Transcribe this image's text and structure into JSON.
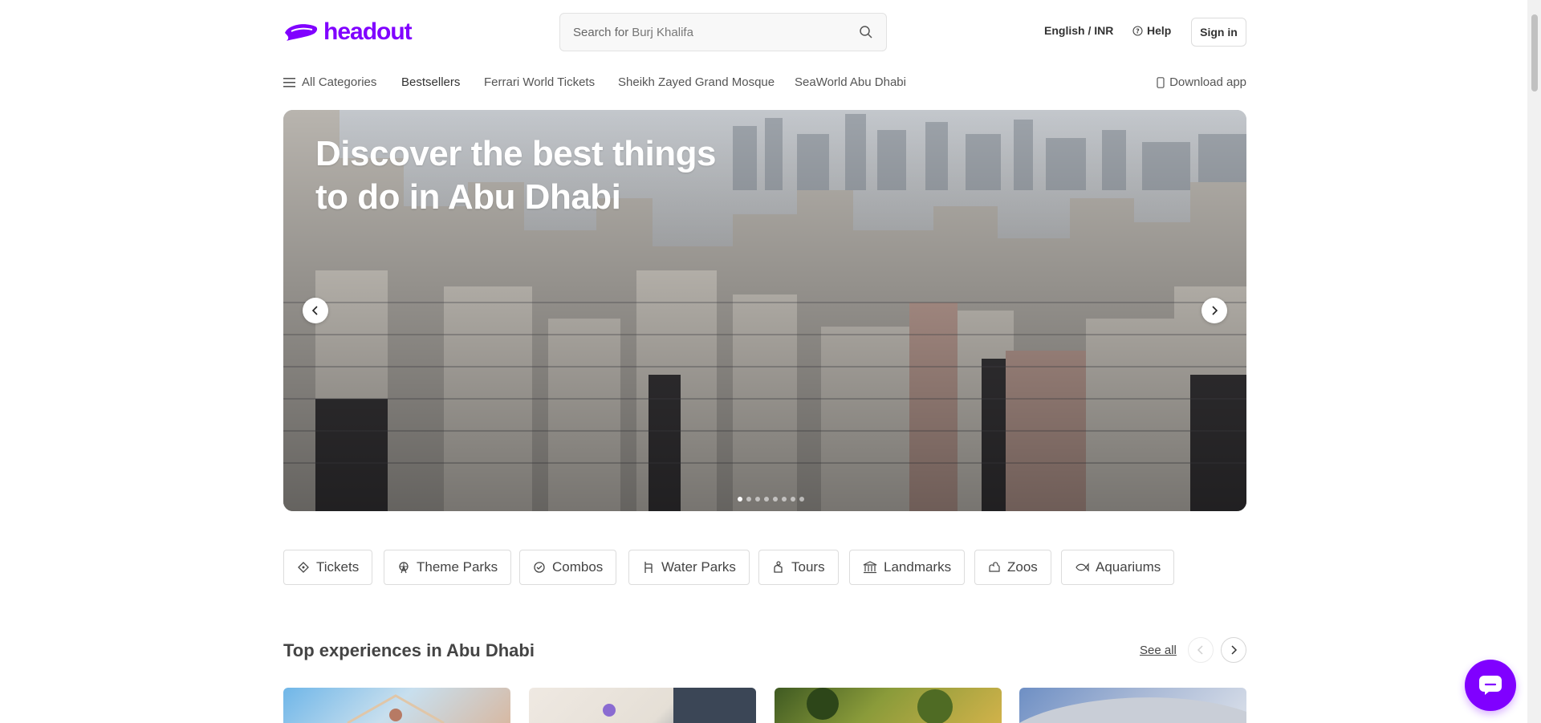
{
  "brand": {
    "name": "headout",
    "color": "#8000ff"
  },
  "header": {
    "search_prefix": "Search for",
    "search_suggestion": "Burj Khalifa",
    "language_currency": "English / INR",
    "help_label": "Help",
    "signin_label": "Sign in"
  },
  "nav": {
    "all_categories": "All Categories",
    "items": [
      "Bestsellers",
      "Ferrari World Tickets",
      "Sheikh Zayed Grand Mosque",
      "SeaWorld Abu Dhabi"
    ],
    "download_label": "Download app"
  },
  "hero": {
    "title_line1": "Discover the best things",
    "title_line2": "to do in Abu Dhabi",
    "slide_count": 8,
    "active_slide": 1
  },
  "categories": [
    {
      "label": "Tickets",
      "icon": "ticket-icon"
    },
    {
      "label": "Theme Parks",
      "icon": "ferris-wheel-icon"
    },
    {
      "label": "Combos",
      "icon": "combo-icon"
    },
    {
      "label": "Water Parks",
      "icon": "water-park-icon"
    },
    {
      "label": "Tours",
      "icon": "tour-icon"
    },
    {
      "label": "Landmarks",
      "icon": "landmark-icon"
    },
    {
      "label": "Zoos",
      "icon": "zoo-icon"
    },
    {
      "label": "Aquariums",
      "icon": "fish-icon"
    }
  ],
  "section": {
    "title": "Top experiences in Abu Dhabi",
    "see_all": "See all"
  }
}
